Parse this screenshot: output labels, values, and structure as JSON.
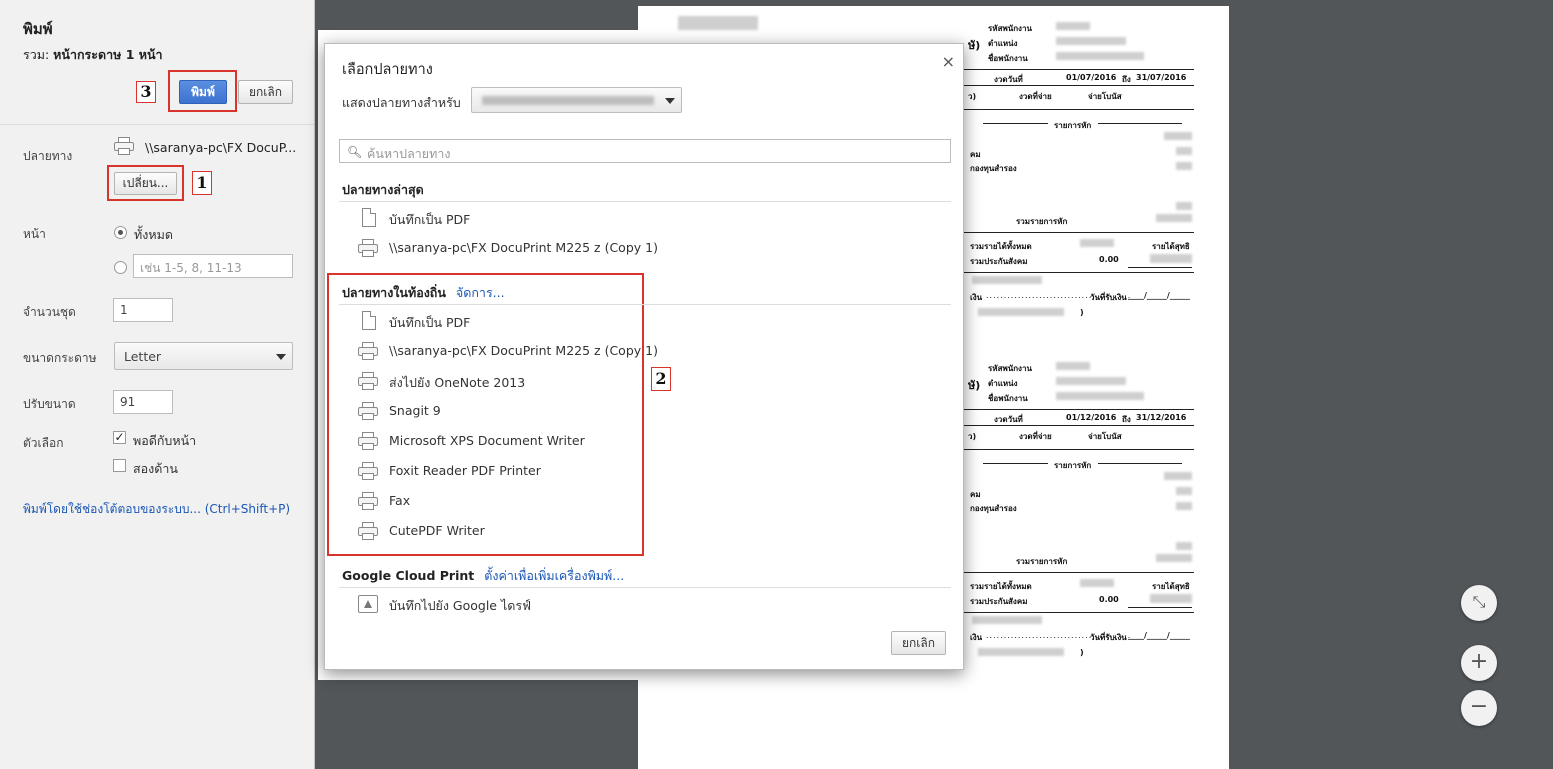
{
  "sidebar": {
    "title": "พิมพ์",
    "summary_prefix": "รวม:",
    "summary_value": "หน้ากระดาษ 1 หน้า",
    "print_button": "พิมพ์",
    "cancel_button": "ยกเลิก",
    "destination_label": "ปลายทาง",
    "destination_value": "\\\\saranya-pc\\FX DocuP...",
    "change_button": "เปลี่ยน...",
    "pages_label": "หน้า",
    "pages_all": "ทั้งหมด",
    "pages_custom_placeholder": "เช่น 1-5, 8, 11-13",
    "copies_label": "จำนวนชุด",
    "copies_value": "1",
    "paper_size_label": "ขนาดกระดาษ",
    "paper_size_value": "Letter",
    "scale_label": "ปรับขนาด",
    "scale_value": "91",
    "options_label": "ตัวเลือก",
    "option_fit": "พอดีกับหน้า",
    "option_fit_checked": true,
    "option_duplex": "สองด้าน",
    "option_duplex_checked": false,
    "system_dialog_link": "พิมพ์โดยใช้ช่องโต้ตอบของระบบ... (Ctrl+Shift+P)"
  },
  "callouts": {
    "one": "1",
    "two": "2",
    "three": "3"
  },
  "dialog": {
    "title": "เลือกปลายทาง",
    "close_glyph": "×",
    "show_for_label": "แสดงปลายทางสำหรับ",
    "search_placeholder": "ค้นหาปลายทาง",
    "recent_header": "ปลายทางล่าสุด",
    "recent": [
      {
        "label": "บันทึกเป็น PDF",
        "icon": "pdf-document-icon"
      },
      {
        "label": "\\\\saranya-pc\\FX DocuPrint M225 z (Copy 1)",
        "icon": "printer-icon"
      }
    ],
    "local_header": "ปลายทางในท้องถิ่น",
    "local_manage_link": "จัดการ...",
    "local": [
      {
        "label": "บันทึกเป็น PDF",
        "icon": "pdf-document-icon"
      },
      {
        "label": "\\\\saranya-pc\\FX DocuPrint M225 z (Copy 1)",
        "icon": "printer-icon"
      },
      {
        "label": "ส่งไปยัง OneNote 2013",
        "icon": "printer-icon"
      },
      {
        "label": "Snagit 9",
        "icon": "printer-icon"
      },
      {
        "label": "Microsoft XPS Document Writer",
        "icon": "printer-icon"
      },
      {
        "label": "Foxit Reader PDF Printer",
        "icon": "printer-icon"
      },
      {
        "label": "Fax",
        "icon": "printer-icon"
      },
      {
        "label": "CutePDF Writer",
        "icon": "printer-icon"
      }
    ],
    "cloud_header": "Google Cloud Print",
    "cloud_setup_link": "ตั้งค่าเพื่อเพิ่มเครื่องพิมพ์...",
    "cloud": [
      {
        "label": "บันทึกไปยัง Google ไดรฟ์",
        "icon": "google-drive-icon"
      }
    ],
    "cancel_button": "ยกเลิก"
  },
  "preview": {
    "slip_top": {
      "employee_id_label": "รหัสพนักงาน",
      "position_label": "ตำแหน่ง",
      "employee_name_label": "ชื่อพนักงาน",
      "period_label": "งวดวันที่",
      "period_from": "01/07/2016",
      "period_to_label": "ถึง",
      "period_to": "31/07/2016",
      "pay_period_label": "งวดที่จ่าย",
      "bonus_label": "จ่ายโบนัส",
      "deductions_label": "รายการหัก",
      "social_label": "คม",
      "fund_label": "กองทุนสำรอง",
      "total_deductions_label": "รวมรายการหัก",
      "total_income_label": "รวมรายได้ทั้งหมด",
      "net_income_label": "รายได้สุทธิ",
      "social_security_label": "รวมประกันสังคม",
      "social_security_value": "0.00",
      "received_date_label": "วันที่รับเงิน",
      "received_date_blank": "____/_____/_____",
      "signature_prefix": "เงิน",
      "close_paren": ")",
      "clipped_header": "ษั)",
      "clipped_paren": "ว)"
    },
    "slip_bottom": {
      "employee_id_label": "รหัสพนักงาน",
      "position_label": "ตำแหน่ง",
      "employee_name_label": "ชื่อพนักงาน",
      "period_label": "งวดวันที่",
      "period_from": "01/12/2016",
      "period_to_label": "ถึง",
      "period_to": "31/12/2016",
      "pay_period_label": "งวดที่จ่าย",
      "bonus_label": "จ่ายโบนัส",
      "deductions_label": "รายการหัก",
      "social_label": "คม",
      "fund_label": "กองทุนสำรอง",
      "total_deductions_label": "รวมรายการหัก",
      "total_income_label": "รวมรายได้ทั้งหมด",
      "net_income_label": "รายได้สุทธิ",
      "social_security_label": "รวมประกันสังคม",
      "social_security_value": "0.00",
      "received_date_label": "วันที่รับเงิน",
      "received_date_blank": "____/_____/_____",
      "signature_prefix": "เงิน",
      "close_paren": ")",
      "clipped_header": "ษั)",
      "clipped_paren": "ว)"
    }
  },
  "zoom": {
    "fit": "⤡",
    "zoom_in": "+",
    "zoom_out": "−"
  },
  "colors": {
    "accent_blue": "#3c73d0",
    "annotation_red": "#d9342b",
    "link_blue": "#1a57b5",
    "preview_background": "#525659"
  }
}
